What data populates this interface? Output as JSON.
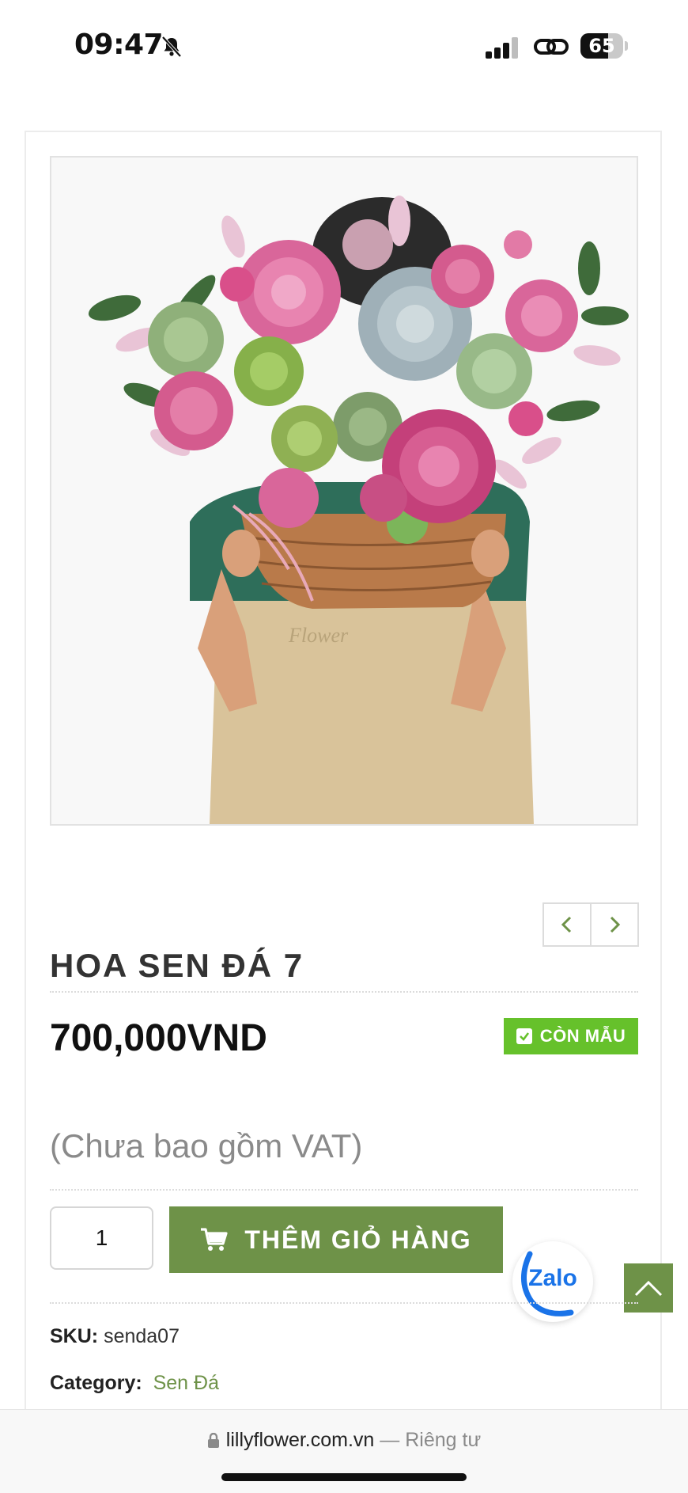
{
  "status_bar": {
    "time": "09:47",
    "battery": "65",
    "battery_level": 0.65,
    "icons": [
      "bell-slash-icon",
      "signal-icon",
      "link-icon",
      "battery-icon"
    ]
  },
  "product": {
    "title": "HOA SEN ĐÁ 7",
    "price": "700,000VND",
    "stock_badge": "CÒN MẪU",
    "vat_note": "(Chưa bao gồm VAT)",
    "quantity": "1",
    "add_to_cart_label": "THÊM GIỎ HÀNG",
    "sku_label": "SKU:",
    "sku_value": "senda07",
    "category_label": "Category:",
    "category_value": "Sen Đá",
    "image_watermark": "Flower"
  },
  "widgets": {
    "zalo_label": "Zalo"
  },
  "browser": {
    "domain": "lillyflower.com.vn",
    "separator": "—",
    "privacy_label": "Riêng tư"
  },
  "colors": {
    "accent_green": "#6e9248",
    "badge_green": "#66c12b",
    "zalo_blue": "#1a73e8"
  }
}
